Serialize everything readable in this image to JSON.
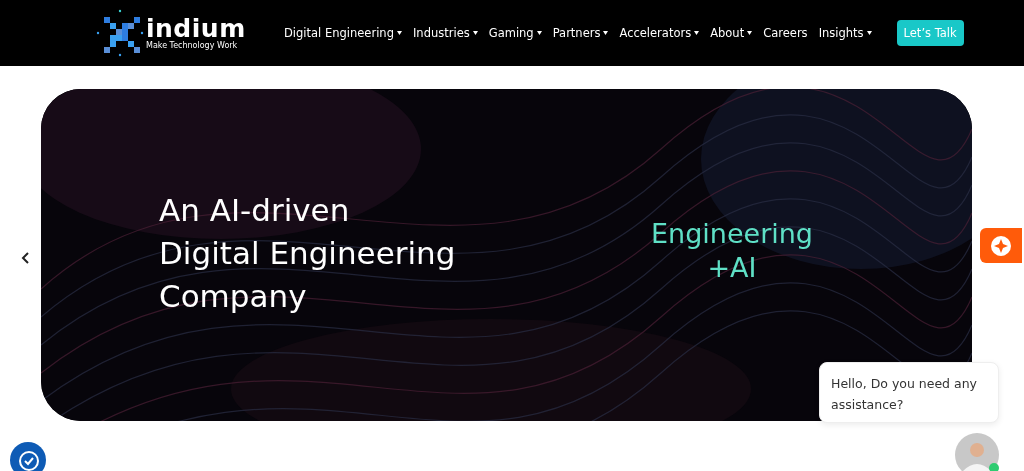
{
  "header": {
    "logo": {
      "name": "indium",
      "tagline": "Make Technology Work"
    },
    "nav": [
      {
        "label": "Digital Engineering",
        "dropdown": true
      },
      {
        "label": "Industries",
        "dropdown": true
      },
      {
        "label": "Gaming",
        "dropdown": true
      },
      {
        "label": "Partners",
        "dropdown": true
      },
      {
        "label": "Accelerators",
        "dropdown": true
      },
      {
        "label": "About",
        "dropdown": true
      },
      {
        "label": "Careers",
        "dropdown": false
      },
      {
        "label": "Insights",
        "dropdown": true
      }
    ],
    "cta": "Let’s Talk"
  },
  "hero": {
    "headline": [
      "An AI-driven",
      "Digital Engineering",
      "Company"
    ],
    "tagline": [
      "Engineering",
      "+AI"
    ]
  },
  "chat": {
    "message": "Hello, Do you need any assistance?",
    "online": true
  }
}
